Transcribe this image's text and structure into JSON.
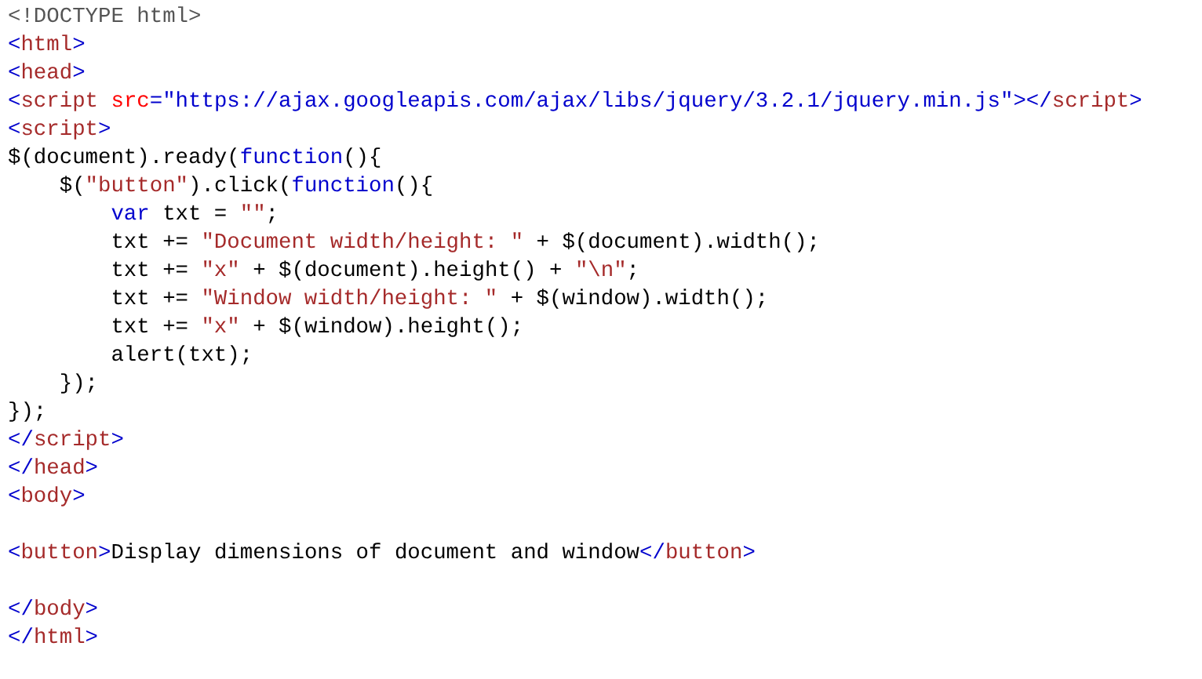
{
  "code_lines": [
    {
      "kind": "code",
      "tokens": [
        {
          "kind": "doctype",
          "text": "<!DOCTYPE html>"
        }
      ]
    },
    {
      "kind": "code",
      "tokens": [
        {
          "kind": "bracket",
          "text": "<"
        },
        {
          "kind": "tag",
          "text": "html"
        },
        {
          "kind": "bracket",
          "text": ">"
        }
      ]
    },
    {
      "kind": "code",
      "tokens": [
        {
          "kind": "bracket",
          "text": "<"
        },
        {
          "kind": "tag",
          "text": "head"
        },
        {
          "kind": "bracket",
          "text": ">"
        }
      ]
    },
    {
      "kind": "code",
      "tokens": [
        {
          "kind": "bracket",
          "text": "<"
        },
        {
          "kind": "tag",
          "text": "script"
        },
        {
          "kind": "attr",
          "text": " src"
        },
        {
          "kind": "value",
          "text": "=\"https://ajax.googleapis.com/ajax/libs/jquery/3.2.1/jquery.min.js\""
        },
        {
          "kind": "bracket",
          "text": "></"
        },
        {
          "kind": "tag",
          "text": "script"
        },
        {
          "kind": "bracket",
          "text": ">"
        }
      ]
    },
    {
      "kind": "code",
      "tokens": [
        {
          "kind": "bracket",
          "text": "<"
        },
        {
          "kind": "tag",
          "text": "script"
        },
        {
          "kind": "bracket",
          "text": ">"
        }
      ]
    },
    {
      "kind": "code",
      "tokens": [
        {
          "kind": "plain",
          "text": "$(document).ready("
        },
        {
          "kind": "keyword",
          "text": "function"
        },
        {
          "kind": "plain",
          "text": "(){"
        }
      ]
    },
    {
      "kind": "code",
      "tokens": [
        {
          "kind": "plain",
          "text": "    $("
        },
        {
          "kind": "string",
          "text": "\"button\""
        },
        {
          "kind": "plain",
          "text": ").click("
        },
        {
          "kind": "keyword",
          "text": "function"
        },
        {
          "kind": "plain",
          "text": "(){"
        }
      ]
    },
    {
      "kind": "code",
      "tokens": [
        {
          "kind": "keyword",
          "text": "        var"
        },
        {
          "kind": "plain",
          "text": " txt = "
        },
        {
          "kind": "string",
          "text": "\"\""
        },
        {
          "kind": "plain",
          "text": ";"
        }
      ]
    },
    {
      "kind": "code",
      "tokens": [
        {
          "kind": "plain",
          "text": "        txt += "
        },
        {
          "kind": "string",
          "text": "\"Document width/height: \""
        },
        {
          "kind": "plain",
          "text": " + $(document).width();"
        }
      ]
    },
    {
      "kind": "code",
      "tokens": [
        {
          "kind": "plain",
          "text": "        txt += "
        },
        {
          "kind": "string",
          "text": "\"x\""
        },
        {
          "kind": "plain",
          "text": " + $(document).height() + "
        },
        {
          "kind": "string",
          "text": "\"\\n\""
        },
        {
          "kind": "plain",
          "text": ";"
        }
      ]
    },
    {
      "kind": "code",
      "tokens": [
        {
          "kind": "plain",
          "text": "        txt += "
        },
        {
          "kind": "string",
          "text": "\"Window width/height: \""
        },
        {
          "kind": "plain",
          "text": " + $(window).width();"
        }
      ]
    },
    {
      "kind": "code",
      "tokens": [
        {
          "kind": "plain",
          "text": "        txt += "
        },
        {
          "kind": "string",
          "text": "\"x\""
        },
        {
          "kind": "plain",
          "text": " + $(window).height();"
        }
      ]
    },
    {
      "kind": "code",
      "tokens": [
        {
          "kind": "plain",
          "text": "        alert(txt);"
        }
      ]
    },
    {
      "kind": "code",
      "tokens": [
        {
          "kind": "plain",
          "text": "    });"
        }
      ]
    },
    {
      "kind": "code",
      "tokens": [
        {
          "kind": "plain",
          "text": "});"
        }
      ]
    },
    {
      "kind": "code",
      "tokens": [
        {
          "kind": "bracket",
          "text": "</"
        },
        {
          "kind": "tag",
          "text": "script"
        },
        {
          "kind": "bracket",
          "text": ">"
        }
      ]
    },
    {
      "kind": "code",
      "tokens": [
        {
          "kind": "bracket",
          "text": "</"
        },
        {
          "kind": "tag",
          "text": "head"
        },
        {
          "kind": "bracket",
          "text": ">"
        }
      ]
    },
    {
      "kind": "code",
      "tokens": [
        {
          "kind": "bracket",
          "text": "<"
        },
        {
          "kind": "tag",
          "text": "body"
        },
        {
          "kind": "bracket",
          "text": ">"
        }
      ]
    },
    {
      "kind": "blank"
    },
    {
      "kind": "code",
      "tokens": [
        {
          "kind": "bracket",
          "text": "<"
        },
        {
          "kind": "tag",
          "text": "button"
        },
        {
          "kind": "bracket",
          "text": ">"
        },
        {
          "kind": "plain",
          "text": "Display dimensions of document and window"
        },
        {
          "kind": "bracket",
          "text": "</"
        },
        {
          "kind": "tag",
          "text": "button"
        },
        {
          "kind": "bracket",
          "text": ">"
        }
      ]
    },
    {
      "kind": "blank"
    },
    {
      "kind": "code",
      "tokens": [
        {
          "kind": "bracket",
          "text": "</"
        },
        {
          "kind": "tag",
          "text": "body"
        },
        {
          "kind": "bracket",
          "text": ">"
        }
      ]
    },
    {
      "kind": "code",
      "tokens": [
        {
          "kind": "bracket",
          "text": "</"
        },
        {
          "kind": "tag",
          "text": "html"
        },
        {
          "kind": "bracket",
          "text": ">"
        }
      ]
    }
  ]
}
